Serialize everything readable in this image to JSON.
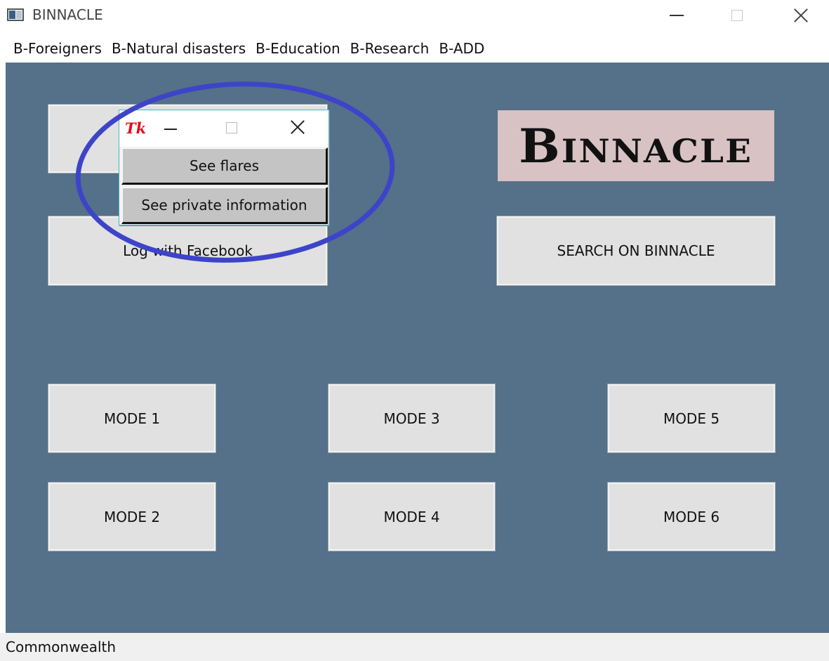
{
  "window": {
    "title": "BINNACLE",
    "icon": "app-window-icon",
    "controls": [
      "minimize-icon",
      "maximize-icon",
      "close-icon"
    ]
  },
  "menubar": {
    "items": [
      {
        "label": "B-Foreigners"
      },
      {
        "label": "B-Natural disasters"
      },
      {
        "label": "B-Education"
      },
      {
        "label": "B-Research"
      },
      {
        "label": "B-ADD"
      }
    ]
  },
  "main": {
    "facebook_button": "Log with Facebook",
    "search_button": "SEARCH ON BINNACLE",
    "logo_text": "Binnacle",
    "modes": [
      {
        "label": "MODE 1"
      },
      {
        "label": "MODE 2"
      },
      {
        "label": "MODE 3"
      },
      {
        "label": "MODE 4"
      },
      {
        "label": "MODE 5"
      },
      {
        "label": "MODE 6"
      }
    ]
  },
  "popup": {
    "icon_text": "Tk",
    "buttons": [
      {
        "label": "See flares"
      },
      {
        "label": "See private information"
      }
    ]
  },
  "statusbar": {
    "text": "Commonwealth"
  },
  "colors": {
    "background": "#557089",
    "button": "#e1e1e1",
    "logo_background": "#d8c2c4",
    "annotation": "#3d44c9",
    "tk_icon": "#e0111a"
  }
}
